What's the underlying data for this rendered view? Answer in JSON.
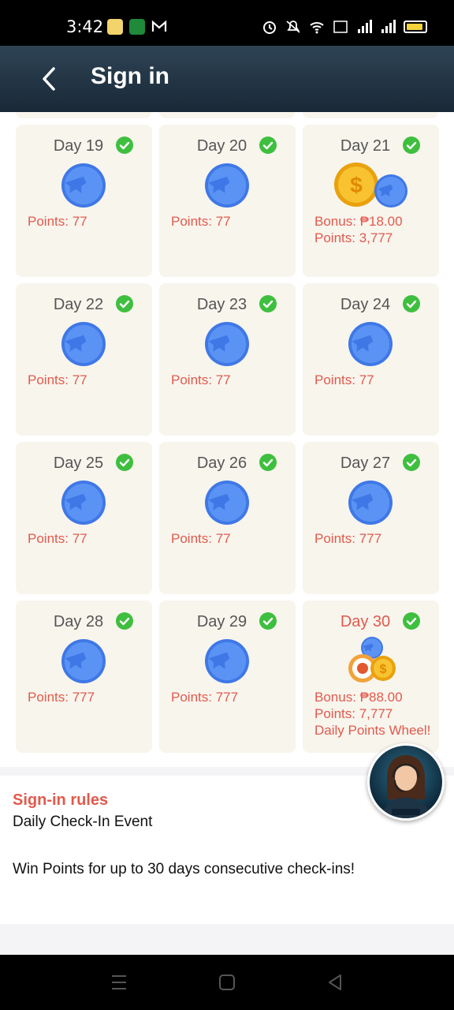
{
  "status_bar": {
    "time": "3:42"
  },
  "app_bar": {
    "title": "Sign in"
  },
  "days": [
    {
      "label": "Day 19",
      "reward": "blue-coin",
      "lines": [
        "Points: 77"
      ]
    },
    {
      "label": "Day 20",
      "reward": "blue-coin",
      "lines": [
        "Points: 77"
      ]
    },
    {
      "label": "Day 21",
      "reward": "gold-and-blue-coin",
      "lines": [
        "Bonus: ₱18.00",
        "Points: 3,777"
      ]
    },
    {
      "label": "Day 22",
      "reward": "blue-coin",
      "lines": [
        "Points: 77"
      ]
    },
    {
      "label": "Day 23",
      "reward": "blue-coin",
      "lines": [
        "Points: 77"
      ]
    },
    {
      "label": "Day 24",
      "reward": "blue-coin",
      "lines": [
        "Points: 77"
      ]
    },
    {
      "label": "Day 25",
      "reward": "blue-coin",
      "lines": [
        "Points: 77"
      ]
    },
    {
      "label": "Day 26",
      "reward": "blue-coin",
      "lines": [
        "Points: 77"
      ]
    },
    {
      "label": "Day 27",
      "reward": "blue-coin",
      "lines": [
        "Points: 777"
      ]
    },
    {
      "label": "Day 28",
      "reward": "blue-coin",
      "lines": [
        "Points: 777"
      ]
    },
    {
      "label": "Day 29",
      "reward": "blue-coin",
      "lines": [
        "Points: 777"
      ]
    },
    {
      "label": "Day 30",
      "reward": "wheel-gold-blue-coin",
      "lines": [
        "Bonus: ₱88.00",
        "Points: 7,777",
        "Daily Points Wheel!"
      ]
    }
  ],
  "rules": {
    "title": "Sign-in rules",
    "line1": "Daily Check-In Event",
    "line2": "Win Points for up to 30 days consecutive check-ins!"
  },
  "colors": {
    "accent_red": "#e15a4d",
    "check_green": "#3fbf3f",
    "card_bg": "#f8f5ed",
    "coin_blue": "#4a86f0",
    "appbar": "#22364a"
  }
}
